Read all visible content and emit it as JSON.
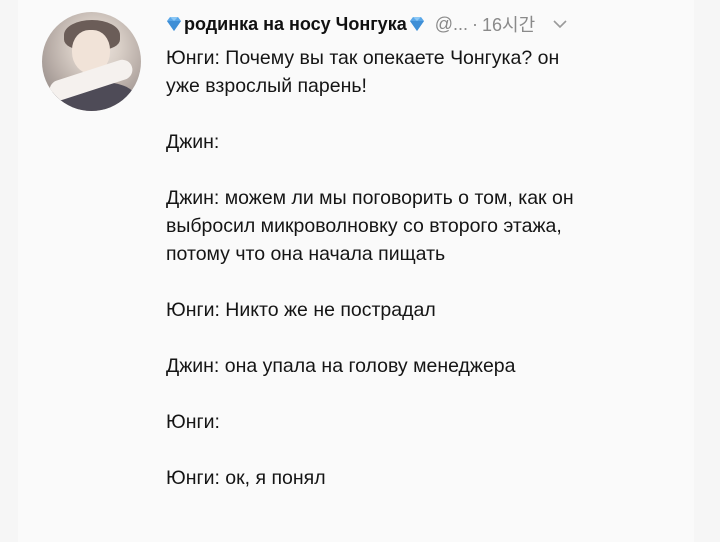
{
  "tweet": {
    "display_name": "родинка на носу Чонгука",
    "handle": "@...",
    "separator": "·",
    "time": "16시간",
    "lines": [
      "Юнги: Почему вы так опекаете Чонгука? он",
      "уже взрослый парень!",
      "",
      "Джин:",
      "",
      "Джин: можем ли мы поговорить о том, как он",
      "выбросил микроволновку со второго этажа,",
      "потому что она начала пищать",
      "",
      "Юнги: Никто же не пострадал",
      "",
      "Джин: она упала на голову менеджера",
      "",
      "Юнги:",
      "",
      "Юнги: ок, я понял"
    ]
  },
  "icons": {
    "name_prefix": "blue-diamond-icon",
    "name_suffix": "blue-diamond-icon",
    "menu": "chevron-down-icon"
  },
  "colors": {
    "diamond": "#5aa7e8",
    "muted_text": "#8a8a8a",
    "body_text": "#151515"
  }
}
